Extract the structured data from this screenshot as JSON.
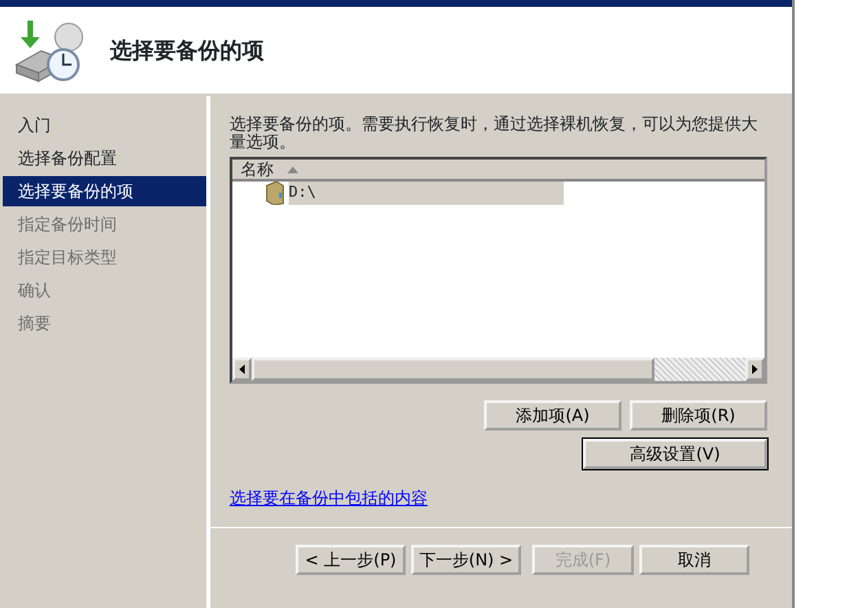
{
  "header": {
    "title": "选择要备份的项"
  },
  "steps": [
    {
      "label": "入门",
      "selected": false,
      "disabled": false
    },
    {
      "label": "选择备份配置",
      "selected": false,
      "disabled": false
    },
    {
      "label": "选择要备份的项",
      "selected": true,
      "disabled": false
    },
    {
      "label": "指定备份时间",
      "selected": false,
      "disabled": true
    },
    {
      "label": "指定目标类型",
      "selected": false,
      "disabled": true
    },
    {
      "label": "确认",
      "selected": false,
      "disabled": true
    },
    {
      "label": "摘要",
      "selected": false,
      "disabled": true
    }
  ],
  "description": "选择要备份的项。需要执行恢复时，通过选择裸机恢复，可以为您提供大量选项。",
  "list": {
    "column_header": "名称",
    "rows": [
      {
        "label": "D:\\",
        "selected": true
      }
    ]
  },
  "item_buttons": [
    {
      "label": "添加项(A)",
      "default": false
    },
    {
      "label": "删除项(R)",
      "default": false
    },
    {
      "label": "高级设置(V)",
      "default": true
    }
  ],
  "link": "选择要在备份中包括的内容",
  "nav_buttons": [
    {
      "label": "< 上一步(P)",
      "disabled": false
    },
    {
      "label": "下一步(N) >",
      "disabled": false
    },
    {
      "label": "完成(F)",
      "disabled": true
    },
    {
      "label": "取消",
      "disabled": false
    }
  ]
}
